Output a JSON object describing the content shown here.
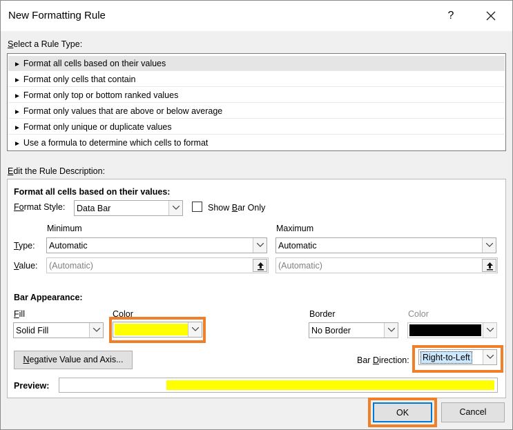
{
  "window": {
    "title": "New Formatting Rule",
    "help": "?",
    "close_icon": "close-icon"
  },
  "rule_type": {
    "label_prefix": "S",
    "label_rest": "elect a Rule Type:",
    "items": [
      "Format all cells based on their values",
      "Format only cells that contain",
      "Format only top or bottom ranked values",
      "Format only values that are above or below average",
      "Format only unique or duplicate values",
      "Use a formula to determine which cells to format"
    ],
    "selected_index": 0
  },
  "description": {
    "label_prefix": "E",
    "label_rest": "dit the Rule Description:",
    "heading": "Format all cells based on their values:",
    "format_style_label_a": "F",
    "format_style_label_b": "o",
    "format_style_label_c": "rmat Style:",
    "format_style_value": "Data Bar",
    "show_bar_only_a": "Show ",
    "show_bar_only_b": "B",
    "show_bar_only_c": "ar Only",
    "show_bar_only_checked": false,
    "minimum_label": "Minimum",
    "maximum_label": "Maximum",
    "type_label_a": "T",
    "type_label_b": "ype:",
    "value_label_a": "V",
    "value_label_b": "alue:",
    "min_type": "Automatic",
    "max_type": "Automatic",
    "min_value_placeholder": "(Automatic)",
    "max_value_placeholder": "(Automatic)"
  },
  "bar_appearance": {
    "heading": "Bar Appearance:",
    "fill_label_a": "F",
    "fill_label_b": "ill",
    "fill_value": "Solid Fill",
    "color_label_a": "C",
    "color_label_b": "olor",
    "fill_color": "#ffff00",
    "border_label": "Border",
    "border_value": "No Border",
    "border_color_label": "Color",
    "border_color": "#000000",
    "negative_button_a": "N",
    "negative_button_b": "egative Value and Axis...",
    "direction_label_a": "Bar ",
    "direction_label_b": "D",
    "direction_label_c": "irection:",
    "direction_value": "Right-to-Left"
  },
  "preview": {
    "label": "Preview:",
    "bar_color": "#ffff00",
    "bar_fraction": 0.75
  },
  "buttons": {
    "ok": "OK",
    "cancel": "Cancel"
  },
  "highlight_color": "#f07f29"
}
